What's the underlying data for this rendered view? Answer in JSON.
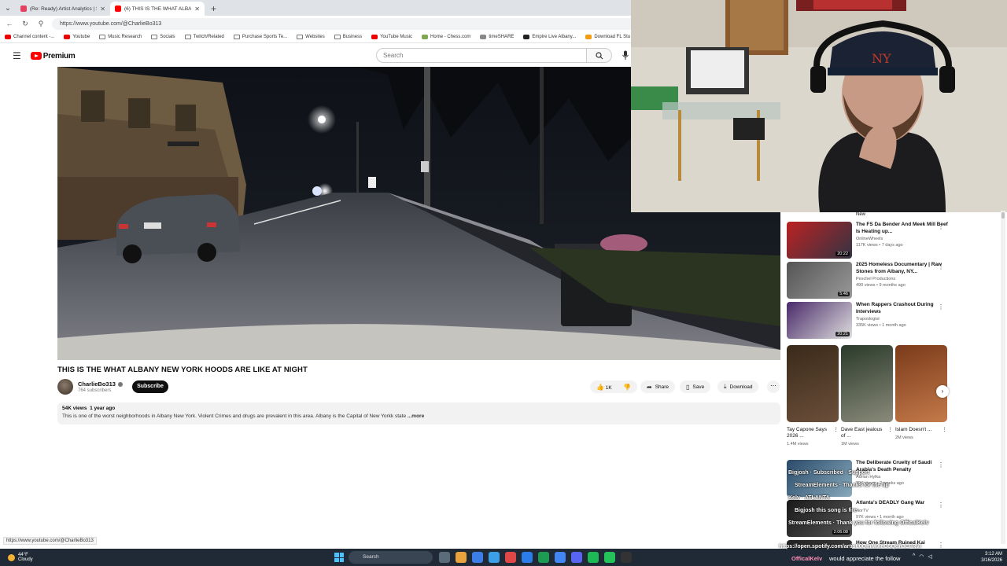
{
  "browser": {
    "tabs": [
      {
        "title": "(Re: Ready) Artist Analytics | Song",
        "active": false,
        "color": "#e4405f"
      },
      {
        "title": "(6) THIS IS THE WHAT ALBANY",
        "active": true,
        "color": "#ff0000"
      }
    ],
    "url": "https://www.youtube.com/@CharlieBo313",
    "bookmarks": [
      {
        "label": "Channel content -...",
        "icon": "red"
      },
      {
        "label": "Youtube",
        "icon": "red"
      },
      {
        "label": "Music Research",
        "icon": "folder"
      },
      {
        "label": "Socials",
        "icon": "folder"
      },
      {
        "label": "Twitch/Related",
        "icon": "folder"
      },
      {
        "label": "Purchase Sports Te...",
        "icon": "folder"
      },
      {
        "label": "Websites",
        "icon": "folder"
      },
      {
        "label": "Business",
        "icon": "folder"
      },
      {
        "label": "YouTube Music",
        "icon": "red"
      },
      {
        "label": "Home - Chess.com",
        "icon": "pawn"
      },
      {
        "label": "timeSHARE",
        "icon": "globe"
      },
      {
        "label": "Empire Live Albany...",
        "icon": "dark"
      },
      {
        "label": "Download FL Stu",
        "icon": "fl"
      }
    ],
    "status_url": "https://www.youtube.com/@CharlieBo313"
  },
  "youtube": {
    "logo_text": "Premium",
    "search_placeholder": "Search"
  },
  "video": {
    "title": "THIS IS THE WHAT ALBANY NEW YORK HOODS ARE LIKE AT NIGHT",
    "channel": "CharlieBo313",
    "subscribers": "764 subscribers",
    "subscribe_label": "Subscribe",
    "likes": "1K",
    "share_label": "Share",
    "save_label": "Save",
    "download_label": "Download",
    "views": "54K views",
    "age": "1 year ago",
    "description": "This is one of the worst neighborhoods in Albany New York. Violent Crimes and drugs are prevalent in this area.  Albany is the Capital of New Yorkk state",
    "more_label": "...more"
  },
  "sidebar": {
    "chip_fragment": "New",
    "recommended": [
      {
        "title": "The FS Da Bender And Meek Mill Beef Is Heating up...",
        "channel": "OnlineWheels",
        "meta": "117K views • 7 days ago",
        "duration": "20:22",
        "colors": [
          "#b22",
          "#334"
        ]
      },
      {
        "title": "2025 Homeless Documentary | Raw Stones from Albany, NY...",
        "channel": "Peschel Productions",
        "meta": "490 views • 9 months ago",
        "duration": "5:46",
        "colors": [
          "#555",
          "#999"
        ]
      },
      {
        "title": "When Rappers Crashout During Interviews",
        "channel": "Traposlogist",
        "meta": "335K views • 1 month ago",
        "duration": "20:21",
        "colors": [
          "#4a2a6a",
          "#ddd"
        ]
      }
    ],
    "shorts": [
      {
        "title": "Tay Capone Says 2026 ...",
        "views": "1.4M views",
        "colors": [
          "#3a2a1a",
          "#6b4f3a"
        ]
      },
      {
        "title": "Dave East jealous of ...",
        "views": "1M views",
        "colors": [
          "#2a3a2a",
          "#8a8a7a"
        ]
      },
      {
        "title": "Islam Doesn't ...",
        "views": "2M views",
        "colors": [
          "#7a3a1a",
          "#c47a4a"
        ]
      }
    ],
    "recommended_2": [
      {
        "title": "The Deliberate Cruelty of Saudi Arabia's Death Penalty",
        "channel": "Adrian Hylka",
        "meta": "39K views • 2 weeks ago",
        "duration": "",
        "colors": [
          "#2a4a6a",
          "#8ab"
        ]
      },
      {
        "title": "Atlanta's DEADLY Gang War",
        "channel": "NorTV",
        "meta": "97K views • 1 month ago",
        "duration": "2:06:08",
        "colors": [
          "#1a1a1a",
          "#555"
        ]
      },
      {
        "title": "How One Stream Ruined Kai",
        "channel": "",
        "meta": "",
        "duration": "",
        "colors": [
          "#222",
          "#444"
        ]
      }
    ]
  },
  "chat": {
    "lines": [
      "Bigjosh · Subscribed · Support",
      "StreamElements · Thanks for the tip",
      "Kelv · ATLANTA",
      "Bigjosh this song is fire",
      "StreamElements · Thank you for following OfficalKelv"
    ],
    "banner_line1": "https://open.spotify.com/artist/0QmIwXeG5Qdn3EFRVI",
    "banner_user": "OfficalKelv",
    "banner_text": "would appreciate the follow"
  },
  "taskbar": {
    "temp": "44°F",
    "weather": "Cloudy",
    "search": "Search",
    "time": "3:12 AM",
    "date": "3/16/2026",
    "icon_colors": [
      "#5a6b7a",
      "#e8a33c",
      "#3c7ee8",
      "#3ca0e8",
      "#e04848",
      "#2b7de9",
      "#1d9b52",
      "#4285f4",
      "#5865f2",
      "#1db954",
      "#25c25a",
      "#333"
    ]
  }
}
